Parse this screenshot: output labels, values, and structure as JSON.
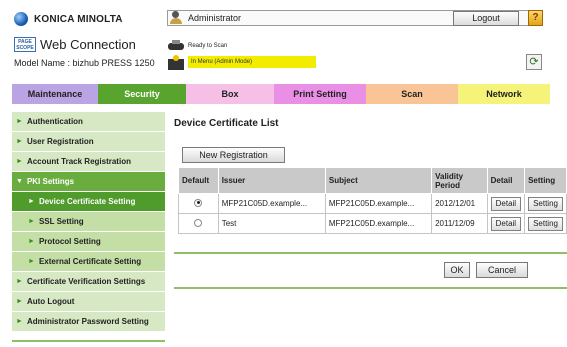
{
  "header": {
    "brand": "KONICA MINOLTA",
    "pagescope_logo": "PAGE SCOPE",
    "product": "Web Connection",
    "model": "Model Name : bizhub PRESS 1250",
    "user": "Administrator",
    "logout_label": "Logout",
    "help_label": "?",
    "status_ready": "Ready to Scan",
    "status_mode": "In Menu (Admin Mode)",
    "refresh_icon": "refresh-icon"
  },
  "tabs": [
    {
      "label": "Maintenance",
      "color": "#bba4e3"
    },
    {
      "label": "Security",
      "color": "#58a42e",
      "active": true
    },
    {
      "label": "Box",
      "color": "#f5bfe6"
    },
    {
      "label": "Print Setting",
      "color": "#ea8fe6"
    },
    {
      "label": "Scan",
      "color": "#f9c597"
    },
    {
      "label": "Network",
      "color": "#f5f37a"
    }
  ],
  "sidebar": {
    "items": [
      {
        "label": "Authentication"
      },
      {
        "label": "User Registration"
      },
      {
        "label": "Account Track Registration"
      },
      {
        "label": "PKI Settings",
        "expanded": true
      },
      {
        "label": "Device Certificate Setting",
        "sub": true,
        "active": true
      },
      {
        "label": "SSL Setting",
        "sub": true
      },
      {
        "label": "Protocol Setting",
        "sub": true
      },
      {
        "label": "External Certificate Setting",
        "sub": true
      },
      {
        "label": "Certificate Verification Settings"
      },
      {
        "label": "Auto Logout"
      },
      {
        "label": "Administrator Password Setting"
      }
    ]
  },
  "main": {
    "title": "Device Certificate List",
    "new_registration_label": "New Registration",
    "columns": [
      "Default",
      "Issuer",
      "Subject",
      "Validity Period",
      "Detail",
      "Setting"
    ],
    "rows": [
      {
        "default": true,
        "issuer": "MFP21C05D.example...",
        "subject": "MFP21C05D.example...",
        "validity": "2012/12/01",
        "detail": "Detail",
        "setting": "Setting"
      },
      {
        "default": false,
        "issuer": "Test",
        "subject": "MFP21C05D.example...",
        "validity": "2011/12/09",
        "detail": "Detail",
        "setting": "Setting"
      }
    ],
    "ok_label": "OK",
    "cancel_label": "Cancel"
  }
}
